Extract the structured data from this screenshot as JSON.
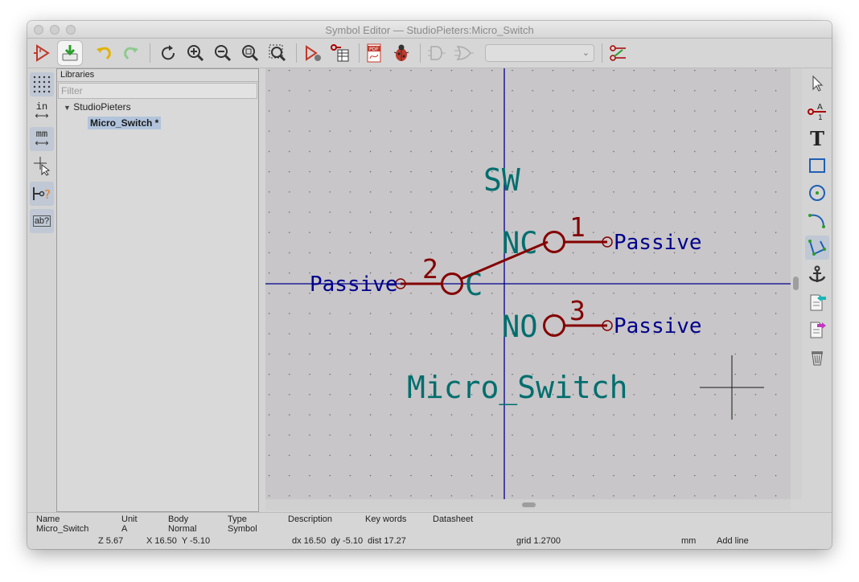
{
  "window": {
    "title": "Symbol Editor — StudioPieters:Micro_Switch"
  },
  "toolbar": {
    "icons": [
      "new-symbol-icon",
      "save-icon",
      "undo-icon",
      "redo-icon",
      "refresh-icon",
      "zoom-in-icon",
      "zoom-out-icon",
      "zoom-fit-icon",
      "zoom-selection-icon",
      "symbol-properties-icon",
      "pin-table-icon",
      "export-pdf-icon",
      "check-symbol-icon",
      "de-morgan-standard-icon",
      "de-morgan-alternate-icon",
      "unit-selector",
      "show-pins-icon"
    ],
    "unit_select_value": ""
  },
  "left_tools": {
    "icons": [
      "grid-icon",
      "inches-icon",
      "millimeters-icon",
      "cursor-crosshair-icon",
      "show-pin-electrical-type-icon",
      "show-field-text-icon"
    ],
    "inch_label": "in",
    "mm_label": "mm",
    "text_label": "ab?"
  },
  "libraries": {
    "header": "Libraries",
    "filter_placeholder": "Filter",
    "library": "StudioPieters",
    "symbol": "Micro_Switch *"
  },
  "schematic": {
    "reference": "SW",
    "value": "Micro_Switch",
    "pins": [
      {
        "number": "1",
        "name": "NC",
        "type": "Passive"
      },
      {
        "number": "2",
        "name": "C",
        "type": "Passive"
      },
      {
        "number": "3",
        "name": "NO",
        "type": "Passive"
      }
    ]
  },
  "right_tools": {
    "icons": [
      "select-arrow-icon",
      "add-pin-icon",
      "add-text-icon",
      "add-rectangle-icon",
      "add-circle-icon",
      "add-arc-icon",
      "add-polyline-icon",
      "anchor-icon",
      "import-graphic-icon",
      "export-graphic-icon",
      "delete-icon"
    ]
  },
  "message_panel": {
    "headers": [
      "Name",
      "Unit",
      "Body",
      "Type",
      "Description",
      "Key words",
      "Datasheet"
    ],
    "values": [
      "Micro_Switch",
      "A",
      "Normal",
      "Symbol",
      "",
      "",
      ""
    ]
  },
  "status": {
    "zoom": "Z 5.67",
    "coords": "X 16.50  Y -5.10",
    "delta": "dx 16.50  dy -5.10  dist 17.27",
    "grid": "grid 1.2700",
    "units": "mm",
    "mode": "Add line"
  },
  "colors": {
    "canvas": "#c8c6c8",
    "pin": "#840000",
    "pin_type_text": "#00008c",
    "field_text": "#006e6e",
    "axis": "#00008c"
  }
}
